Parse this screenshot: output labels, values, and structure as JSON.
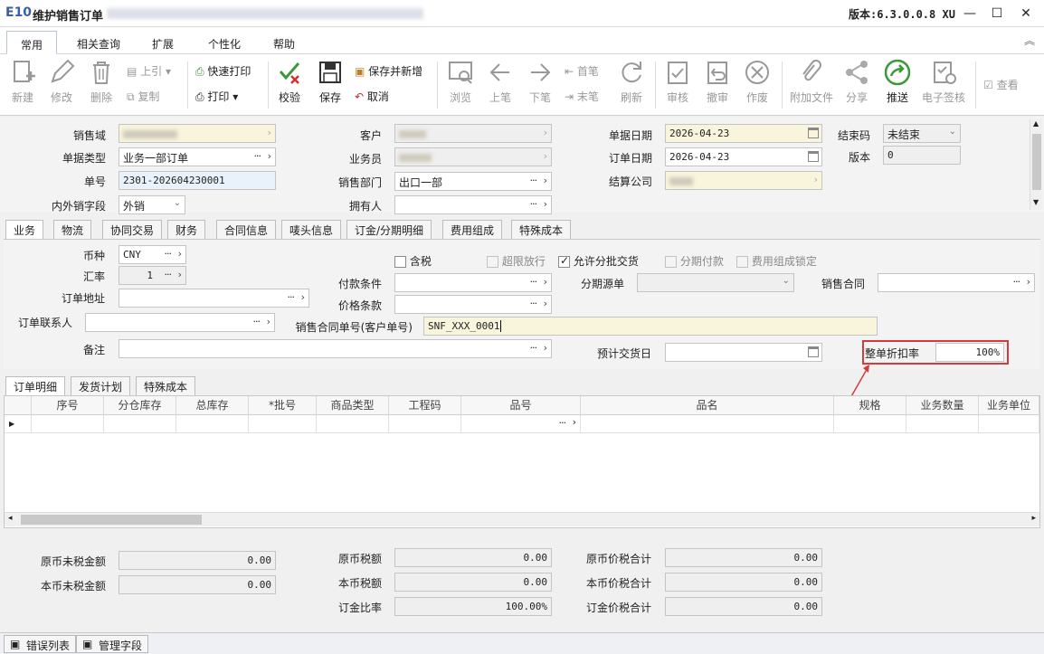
{
  "window": {
    "logo": "E10",
    "title": "维护销售订单",
    "version": "版本:6.3.0.0.8 XU",
    "controls": {
      "min": "—",
      "max": "☐",
      "close": "✕"
    }
  },
  "ribbon": {
    "tabs": [
      "常用",
      "相关查询",
      "扩展",
      "个性化",
      "帮助"
    ]
  },
  "toolbar": {
    "new": "新建",
    "edit": "修改",
    "delete": "删除",
    "prev_ref": "上引",
    "copy": "复制",
    "quick_print": "快速打印",
    "print": "打印",
    "check": "校验",
    "save": "保存",
    "save_new": "保存并新增",
    "cancel": "取消",
    "browse": "浏览",
    "prev": "上笔",
    "next": "下笔",
    "first": "首笔",
    "last": "末笔",
    "refresh": "刷新",
    "approve": "审核",
    "unapprove": "撤审",
    "void": "作废",
    "attach": "附加文件",
    "share": "分享",
    "push": "推送",
    "esign": "电子签核",
    "view": "查看"
  },
  "header": {
    "sales_domain_label": "销售域",
    "doc_type_label": "单据类型",
    "doc_type_value": "业务一部订单",
    "doc_no_label": "单号",
    "doc_no_value": "2301-202604230001",
    "inout_label": "内外销字段",
    "inout_value": "外销",
    "customer_label": "客户",
    "salesman_label": "业务员",
    "sales_dept_label": "销售部门",
    "sales_dept_value": "出口一部",
    "owner_label": "拥有人",
    "doc_date_label": "单据日期",
    "doc_date_value": "2026-04-23",
    "order_date_label": "订单日期",
    "order_date_value": "2026-04-23",
    "settle_company_label": "结算公司",
    "close_code_label": "结束码",
    "close_code_value": "未结束",
    "version_label": "版本",
    "version_value": "0"
  },
  "tabs": [
    "业务",
    "物流",
    "协同交易",
    "财务",
    "合同信息",
    "唛头信息",
    "订金/分期明细",
    "费用组成",
    "特殊成本"
  ],
  "business": {
    "currency_label": "币种",
    "currency_value": "CNY",
    "rate_label": "汇率",
    "rate_value": "1",
    "address_label": "订单地址",
    "contact_label": "订单联系人",
    "remark_label": "备注",
    "tax_included": "含税",
    "over_limit": "超限放行",
    "allow_batch": "允许分批交货",
    "installment": "分期付款",
    "fee_lock": "费用组成锁定",
    "payment_label": "付款条件",
    "price_terms_label": "价格条款",
    "contract_no_label": "销售合同单号(客户单号)",
    "contract_no_value": "SNF_XXX_0001",
    "installment_src_label": "分期源单",
    "sales_contract_label": "销售合同",
    "expected_date_label": "预计交货日",
    "discount_label": "整单折扣率",
    "discount_value": "100%"
  },
  "detail_tabs": [
    "订单明细",
    "发货计划",
    "特殊成本"
  ],
  "grid": {
    "columns": [
      "序号",
      "分仓库存",
      "总库存",
      "*批号",
      "商品类型",
      "工程码",
      "品号",
      "品名",
      "规格",
      "业务数量",
      "业务单位"
    ]
  },
  "totals": {
    "orig_untaxed_label": "原币未税金额",
    "orig_untaxed_value": "0.00",
    "local_untaxed_label": "本币未税金额",
    "local_untaxed_value": "0.00",
    "orig_tax_label": "原币税额",
    "orig_tax_value": "0.00",
    "local_tax_label": "本币税额",
    "local_tax_value": "0.00",
    "deposit_ratio_label": "订金比率",
    "deposit_ratio_value": "100.00%",
    "orig_total_label": "原币价税合计",
    "orig_total_value": "0.00",
    "local_total_label": "本币价税合计",
    "local_total_value": "0.00",
    "deposit_total_label": "订金价税合计",
    "deposit_total_value": "0.00"
  },
  "bottom_tabs": [
    "错误列表",
    "管理字段"
  ],
  "colors": {
    "highlight": "#d43c3c",
    "accent": "#3a5ea8",
    "required_bg": "#f8f5dc"
  }
}
